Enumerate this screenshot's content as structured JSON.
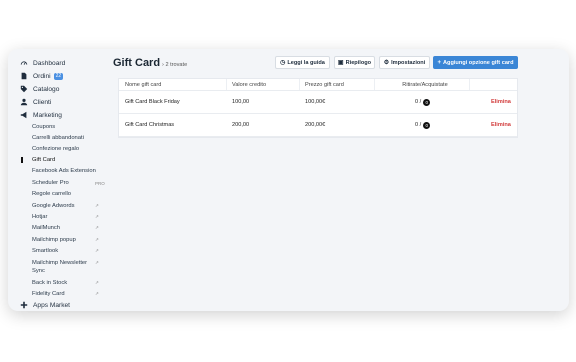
{
  "sidebar": {
    "items": [
      {
        "label": "Dashboard",
        "icon": "dashboard-icon"
      },
      {
        "label": "Ordini",
        "icon": "document-icon",
        "badge": "22"
      },
      {
        "label": "Catalogo",
        "icon": "tag-icon"
      },
      {
        "label": "Clienti",
        "icon": "user-icon"
      },
      {
        "label": "Marketing",
        "icon": "megaphone-icon"
      }
    ],
    "marketing_sub": [
      {
        "label": "Coupons"
      },
      {
        "label": "Carrelli abbandonati"
      },
      {
        "label": "Confezione regalo"
      },
      {
        "label": "Gift Card",
        "active": true
      },
      {
        "label": "Facebook Ads Extension"
      },
      {
        "label": "Scheduler Pro",
        "ext": "PRO"
      },
      {
        "label": "Regole carrello"
      },
      {
        "label": "Google Adwords",
        "ext": "↗"
      },
      {
        "label": "Hotjar",
        "ext": "↗"
      },
      {
        "label": "MailMunch",
        "ext": "↗"
      },
      {
        "label": "Mailchimp popup",
        "ext": "↗"
      },
      {
        "label": "Smartlook",
        "ext": "↗"
      },
      {
        "label": "Mailchimp Newsletter",
        "ext": "↗"
      },
      {
        "label": "Sync"
      },
      {
        "label": "Back in Stock",
        "ext": "↗"
      },
      {
        "label": "Fidelity Card",
        "ext": "↗"
      }
    ],
    "apps_market": "Apps Market"
  },
  "header": {
    "title": "Gift Card",
    "crumb_sep": "›",
    "count": "2 trovate",
    "buttons": {
      "guide": "Leggi la guida",
      "summary": "Riepilogo",
      "settings": "Impostazioni",
      "add": "Aggiungi opzione gift card"
    }
  },
  "table": {
    "headers": [
      "Nome gift card",
      "Valore credito",
      "Prezzo gift card",
      "Ritirate/Acquistate",
      ""
    ],
    "rows": [
      {
        "name": "Gift Card Black Friday",
        "credit": "100,00",
        "price": "100,00€",
        "ratio": "0 /",
        "badge": "0",
        "action": "Elimina"
      },
      {
        "name": "Gift Card Christmas",
        "credit": "200,00",
        "price": "200,00€",
        "ratio": "0 /",
        "badge": "0",
        "action": "Elimina"
      }
    ]
  },
  "colors": {
    "accent": "#3b86d6",
    "danger": "#d23b3b",
    "badge": "#4a90e2"
  }
}
